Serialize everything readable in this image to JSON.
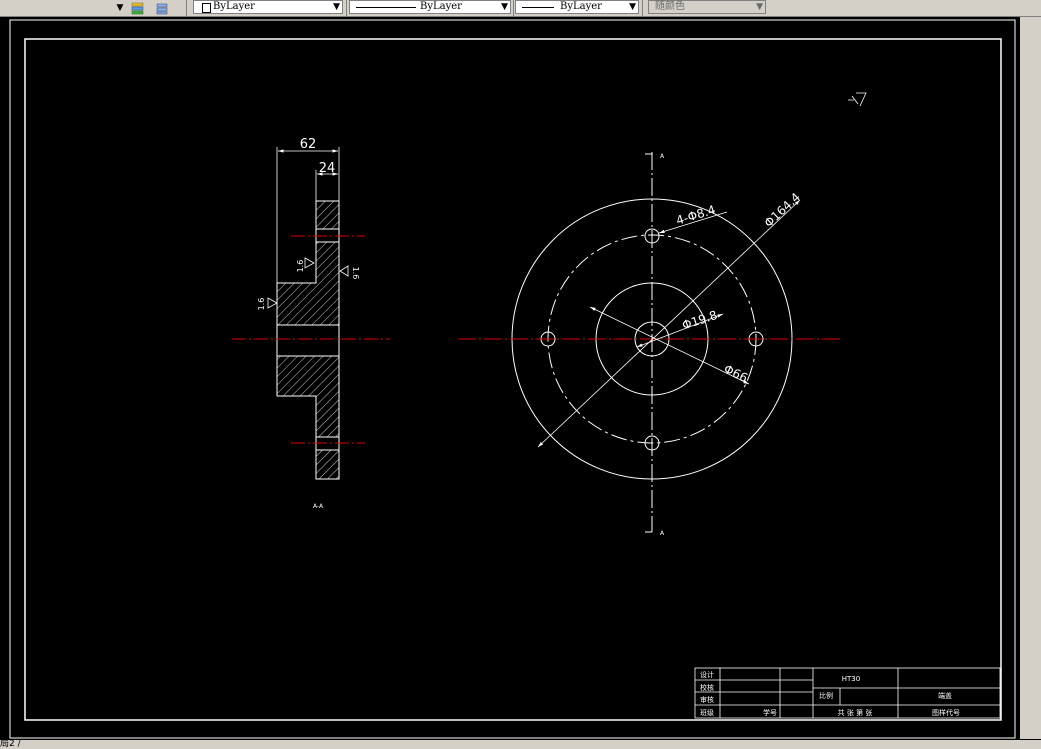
{
  "toolbar": {
    "layer_label": "ByLayer",
    "linetype_label": "ByLayer",
    "lineweight_label": "ByLayer",
    "plotstyle_label": "随颜色"
  },
  "side_view": {
    "dim_overall_width": "62",
    "dim_flange_width": "24",
    "roughness_1": "1.6",
    "roughness_2": "1.6",
    "roughness_3": "1.6",
    "section_label": "A-A"
  },
  "front_view": {
    "dim_holes": "4-Φ8.4",
    "dim_outer": "Φ164.4",
    "dim_bore": "Φ19.8",
    "dim_hub": "Φ66",
    "section_mark_top": "A",
    "section_mark_bottom": "A"
  },
  "title_block": {
    "material": "HT30",
    "row_design": "设计",
    "row_check": "校核",
    "row_review": "审核",
    "row_class": "班级",
    "student_no": "学号",
    "scale_label": "比例",
    "sheet_info": "共  张 第  张",
    "part_name": "端盖",
    "drawing_no": "图样代号"
  },
  "misc": {
    "tab_label": "局2 /"
  },
  "colors": {
    "background": "#000000",
    "lines": "#ffffff",
    "centerline": "#ff0000",
    "ui_face": "#d4d0c8"
  }
}
